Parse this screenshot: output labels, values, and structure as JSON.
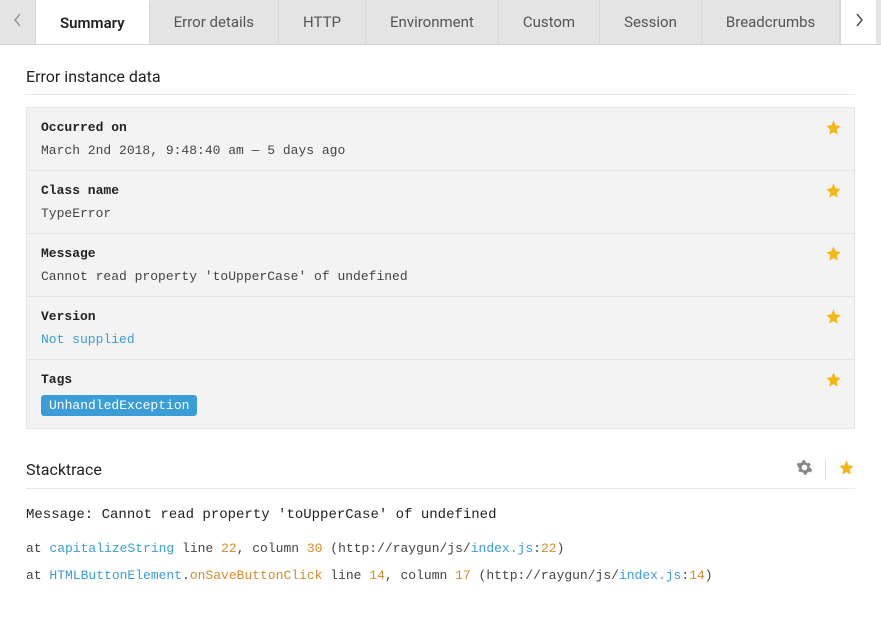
{
  "tabs": {
    "items": [
      {
        "label": "Summary",
        "active": true
      },
      {
        "label": "Error details"
      },
      {
        "label": "HTTP"
      },
      {
        "label": "Environment"
      },
      {
        "label": "Custom"
      },
      {
        "label": "Session"
      },
      {
        "label": "Breadcrumbs"
      }
    ]
  },
  "error_instance": {
    "heading": "Error instance data",
    "panels": {
      "occurred_on": {
        "label": "Occurred on",
        "value": "March 2nd 2018, 9:48:40 am — 5 days ago"
      },
      "class_name": {
        "label": "Class name",
        "value": "TypeError"
      },
      "message": {
        "label": "Message",
        "value": "Cannot read property 'toUpperCase' of undefined"
      },
      "version": {
        "label": "Version",
        "value": "Not supplied"
      },
      "tags": {
        "label": "Tags",
        "value": "UnhandledException"
      }
    }
  },
  "stacktrace": {
    "heading": "Stacktrace",
    "message": "Message: Cannot read property 'toUpperCase' of undefined",
    "frames": [
      {
        "prefix": "at ",
        "fn": "capitalizeString",
        "sep1": " line ",
        "line": "22",
        "sep2": ", column ",
        "col": "30",
        "paren_open": " (http://raygun/js/",
        "file": "index.js",
        "colon": ":",
        "fline": "22",
        "paren_close": ")"
      },
      {
        "prefix": "at ",
        "cls": "HTMLButtonElement",
        "dot": ".",
        "evt": "onSaveButtonClick",
        "sep1": " line ",
        "line": "14",
        "sep2": ", column ",
        "col": "17",
        "paren_open": " (http://raygun/js/",
        "file": "index.js",
        "colon": ":",
        "fline": "14",
        "paren_close": ")"
      }
    ]
  }
}
